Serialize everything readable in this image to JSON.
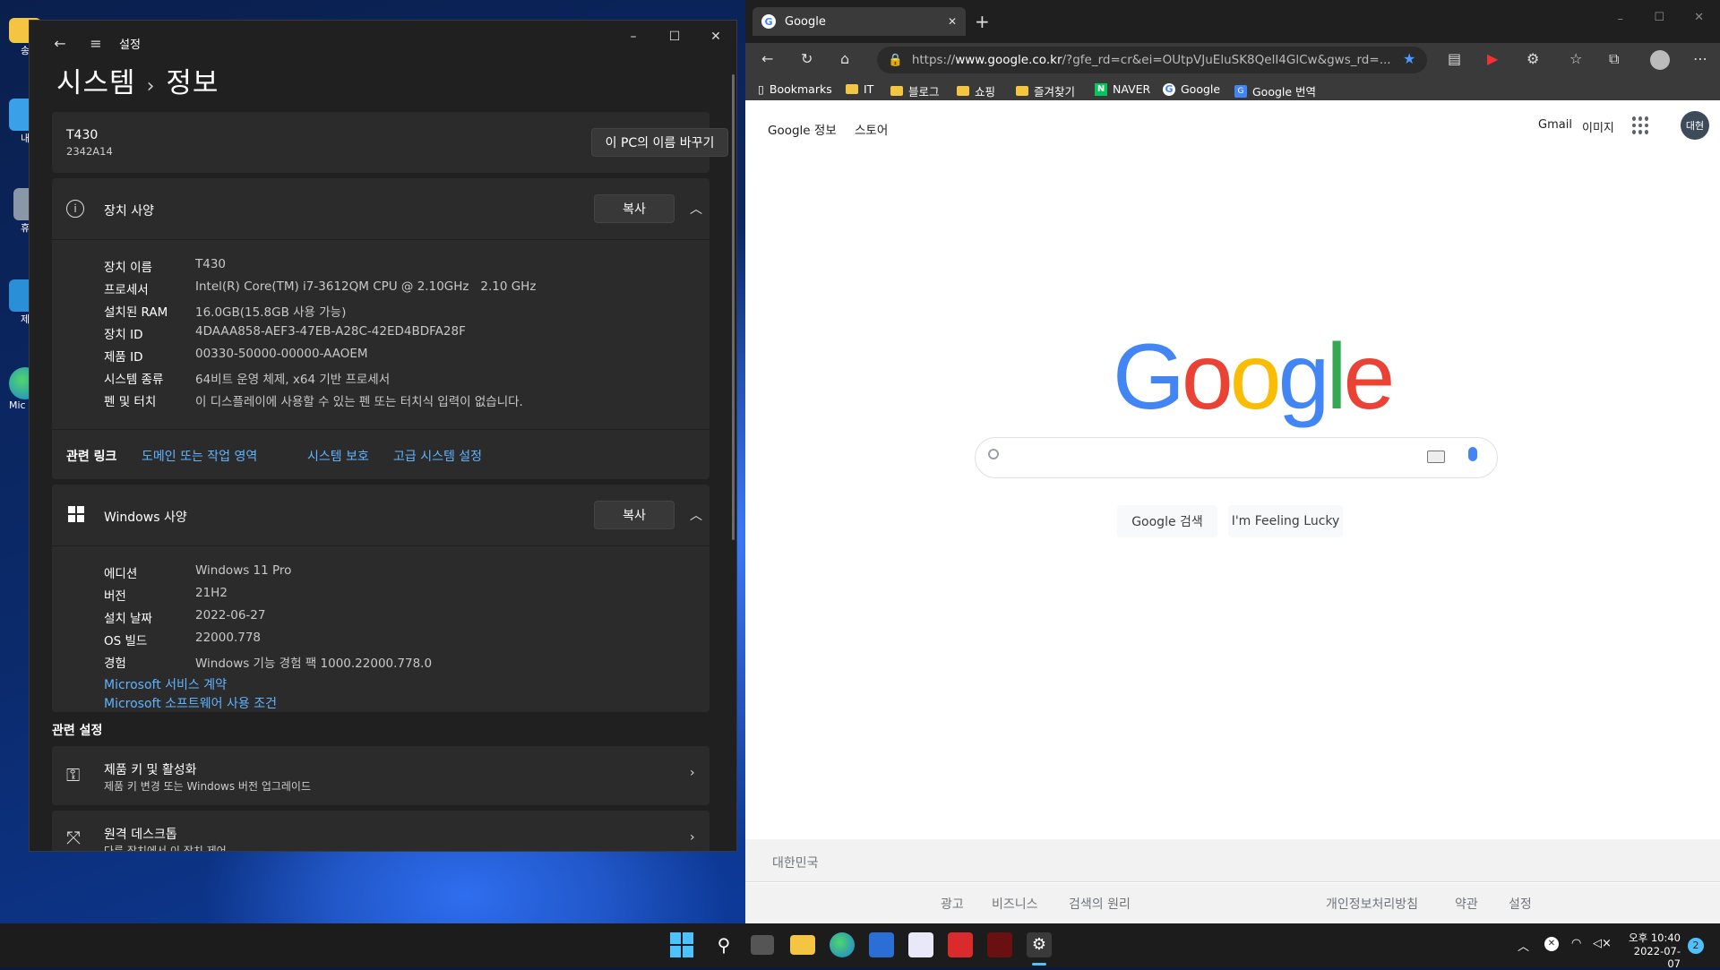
{
  "desktop": {
    "icons": [
      {
        "label": "송"
      },
      {
        "label": "내"
      },
      {
        "label": "휴"
      },
      {
        "label": "제"
      },
      {
        "label": "Mic Ed"
      }
    ]
  },
  "settings": {
    "app_title": "설정",
    "breadcrumb": {
      "parent": "시스템",
      "separator": "›",
      "current": "정보"
    },
    "pc": {
      "name": "T430",
      "model": "2342A14",
      "rename_label": "이 PC의 이름 바꾸기"
    },
    "device_specs": {
      "title": "장치 사양",
      "copy_label": "복사",
      "rows": [
        {
          "key": "장치 이름",
          "value": "T430"
        },
        {
          "key": "프로세서",
          "value": "Intel(R) Core(TM) i7-3612QM CPU @ 2.10GHz   2.10 GHz"
        },
        {
          "key": "설치된 RAM",
          "value": "16.0GB(15.8GB 사용 가능)"
        },
        {
          "key": "장치 ID",
          "value": "4DAAA858-AEF3-47EB-A28C-42ED4BDFA28F"
        },
        {
          "key": "제품 ID",
          "value": "00330-50000-00000-AAOEM"
        },
        {
          "key": "시스템 종류",
          "value": "64비트 운영 체제, x64 기반 프로세서"
        },
        {
          "key": "펜 및 터치",
          "value": "이 디스플레이에 사용할 수 있는 펜 또는 터치식 입력이 없습니다."
        }
      ]
    },
    "related_links": {
      "label": "관련 링크",
      "links": [
        "도메인 또는 작업 영역",
        "시스템 보호",
        "고급 시스템 설정"
      ]
    },
    "windows_specs": {
      "title": "Windows 사양",
      "copy_label": "복사",
      "rows": [
        {
          "key": "에디션",
          "value": "Windows 11 Pro"
        },
        {
          "key": "버전",
          "value": "21H2"
        },
        {
          "key": "설치 날짜",
          "value": "2022-06-27"
        },
        {
          "key": "OS 빌드",
          "value": "22000.778"
        },
        {
          "key": "경험",
          "value": "Windows 기능 경험 팩 1000.22000.778.0"
        }
      ],
      "links": [
        "Microsoft 서비스 계약",
        "Microsoft 소프트웨어 사용 조건"
      ]
    },
    "related_settings": {
      "label": "관련 설정",
      "items": [
        {
          "title": "제품 키 및 활성화",
          "subtitle": "제품 키 변경 또는 Windows 버전 업그레이드"
        },
        {
          "title": "원격 데스크톱",
          "subtitle": "다른 장치에서 이 장치 제어"
        }
      ]
    }
  },
  "edge": {
    "tab_title": "Google",
    "url_prefix": "https://",
    "url_host": "www.google.co.kr",
    "url_rest": "/?gfe_rd=cr&ei=OUtpVJuEluSK8QelI4GlCw&gws_rd=...",
    "bookmarks": [
      "Bookmarks",
      "IT",
      "블로그",
      "쇼핑",
      "즐겨찾기",
      "NAVER",
      "Google",
      "Google 번역"
    ]
  },
  "google": {
    "top_left": [
      "Google 정보",
      "스토어"
    ],
    "top_right": [
      "Gmail",
      "이미지"
    ],
    "avatar": "대현",
    "logo_letters": [
      {
        "ch": "G",
        "color": "#4285F4"
      },
      {
        "ch": "o",
        "color": "#EA4335"
      },
      {
        "ch": "o",
        "color": "#FBBC05"
      },
      {
        "ch": "g",
        "color": "#4285F4"
      },
      {
        "ch": "l",
        "color": "#34A853"
      },
      {
        "ch": "e",
        "color": "#EA4335"
      }
    ],
    "search_button": "Google 검색",
    "lucky_button": "I'm Feeling Lucky",
    "country": "대한민국",
    "footer_left": [
      "광고",
      "비즈니스",
      "검색의 원리"
    ],
    "footer_right": [
      "개인정보처리방침",
      "약관",
      "설정"
    ]
  },
  "taskbar": {
    "time": "오후 10:40",
    "date": "2022-07-07",
    "notifications": "2"
  }
}
